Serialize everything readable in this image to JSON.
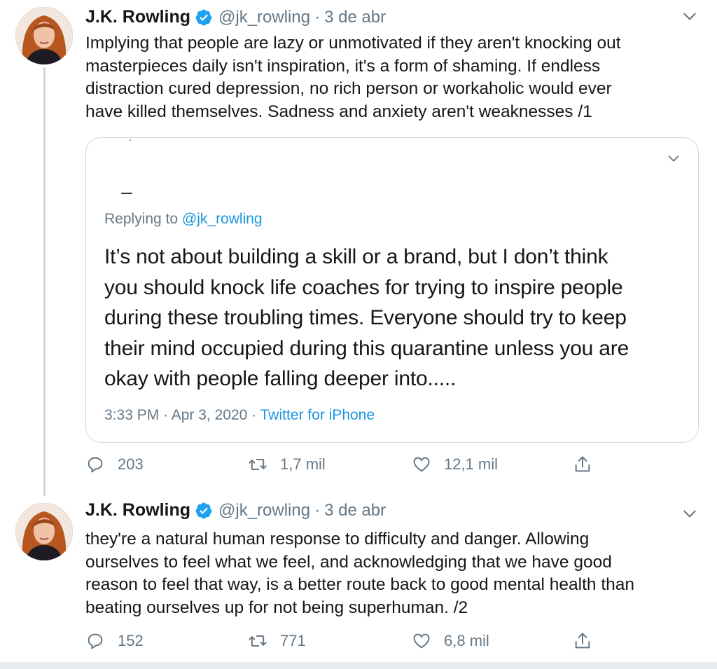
{
  "tweets": [
    {
      "author": {
        "name": "J.K. Rowling",
        "handle": "@jk_rowling",
        "verified": true
      },
      "separator": "·",
      "date": "3 de abr",
      "text": "Implying that people are lazy or unmotivated if they aren't knocking out\nmasterpieces daily isn't inspiration, it's a form of shaming. If endless\ndistraction cured depression, no rich person or workaholic would ever\nhave killed themselves. Sadness and anxiety aren't weaknesses /1",
      "quote": {
        "replying_prefix": "Replying to ",
        "replying_handle": "@jk_rowling",
        "text": "It’s not about building a skill or a brand, but I don’t think\nyou should knock life coaches for trying to inspire people\nduring these troubling times. Everyone should try to keep\ntheir mind occupied during this quarantine unless you are\nokay with people falling deeper into.....",
        "time": "3:33 PM",
        "date": "Apr 3, 2020",
        "separator": " · ",
        "source": "Twitter for iPhone"
      },
      "stats": {
        "replies": "203",
        "retweets": "1,7 mil",
        "likes": "12,1 mil"
      }
    },
    {
      "author": {
        "name": "J.K. Rowling",
        "handle": "@jk_rowling",
        "verified": true
      },
      "separator": "·",
      "date": "3 de abr",
      "text": "they're a natural human response to difficulty and danger. Allowing\nourselves to feel what we feel, and acknowledging that we have good\nreason to feel that way, is a better route back to good mental health than\nbeating ourselves up for not being superhuman. /2",
      "stats": {
        "replies": "152",
        "retweets": "771",
        "likes": "6,8 mil"
      }
    }
  ],
  "icons": {
    "verified": "verified-badge-icon",
    "caret": "chevron-down-icon",
    "reply": "reply-icon",
    "retweet": "retweet-icon",
    "like": "heart-icon",
    "share": "share-icon"
  },
  "colors": {
    "text": "#14171a",
    "secondary": "#657786",
    "link": "#1b95e0",
    "verified": "#1da1f2",
    "border": "#ccd6dd"
  }
}
